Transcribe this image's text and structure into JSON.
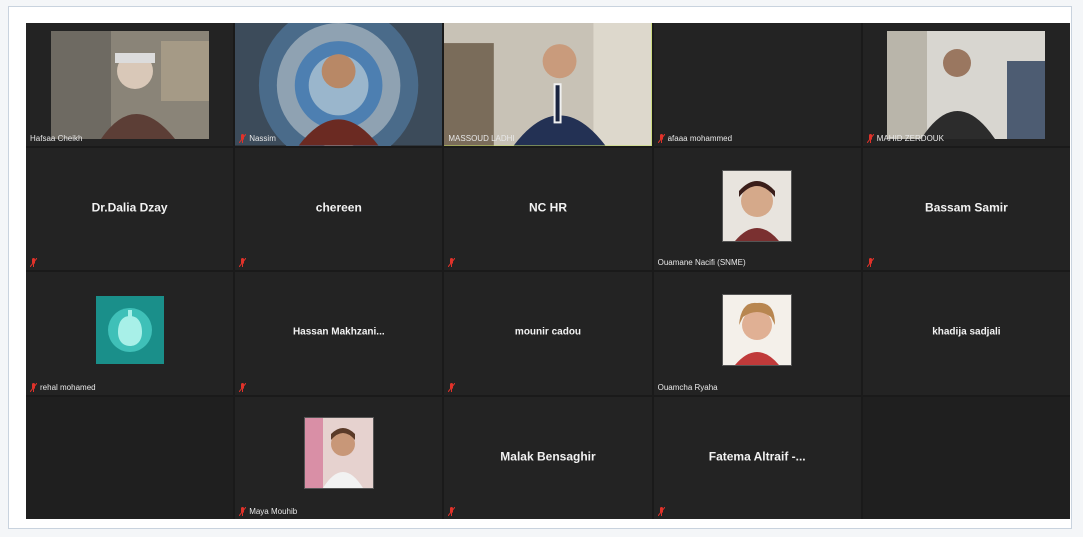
{
  "colors": {
    "background": "#f4f6f8",
    "grid_bg": "#1a1a1a",
    "tile_bg": "#232323",
    "active_border": "#c8e060",
    "mic_muted": "#e0322a",
    "name_text": "#f2f2f2"
  },
  "participants": [
    {
      "label": "Hafsaa Cheikh",
      "type": "video",
      "muted": false
    },
    {
      "label": "Nassim",
      "type": "video",
      "muted": true
    },
    {
      "label": "MASSOUD LADHI",
      "type": "video",
      "muted": false,
      "active": true
    },
    {
      "label": "afaaa mohammed",
      "type": "video-off",
      "muted": true
    },
    {
      "label": "MAHID ZERDOUK",
      "type": "video",
      "muted": true
    },
    {
      "display": "Dr.Dalia Dzay",
      "type": "name",
      "muted": true
    },
    {
      "display": "chereen",
      "type": "name",
      "muted": true
    },
    {
      "display": "NC HR",
      "type": "name",
      "muted": true
    },
    {
      "label": "Ouamane Nacifi (SNME)",
      "type": "photo",
      "muted": false
    },
    {
      "display": "Bassam Samir",
      "type": "name",
      "muted": true
    },
    {
      "label": "rehal mohamed",
      "type": "avatar",
      "muted": true
    },
    {
      "display": "Hassan Makhzani...",
      "type": "name",
      "muted": true
    },
    {
      "display": "mounir cadou",
      "type": "name",
      "muted": true
    },
    {
      "label": "Ouamcha Ryaha",
      "type": "photo",
      "muted": false
    },
    {
      "display": "khadija sadjali",
      "type": "name",
      "muted": false
    },
    {
      "type": "empty"
    },
    {
      "label": "Maya Mouhib",
      "type": "photo",
      "muted": true
    },
    {
      "display": "Malak Bensaghir",
      "type": "name",
      "muted": true
    },
    {
      "display": "Fatema Altraif -...",
      "type": "name",
      "muted": true
    },
    {
      "type": "empty"
    }
  ]
}
